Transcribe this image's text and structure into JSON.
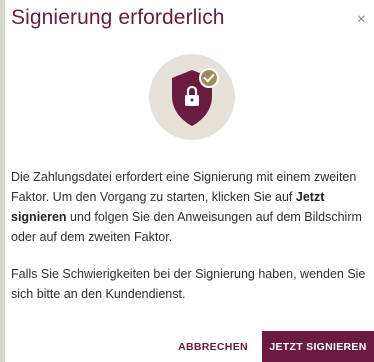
{
  "dialog": {
    "title": "Signierung erforderlich",
    "close_label": "×",
    "paragraph1": {
      "before": "Die Zahlungsdatei erfordert eine Signierung mit einem zweiten Faktor. Um den Vorgang zu starten, klicken Sie auf ",
      "bold": "Jetzt signieren",
      "after": " und folgen Sie den Anweisungen auf dem Bildschirm oder auf dem zweiten Faktor."
    },
    "paragraph2": "Falls Sie Schwierigkeiten bei der Signierung haben, wenden Sie sich bitte an den Kundendienst.",
    "cancel_label": "ABBRECHEN",
    "sign_label": "JETZT SIGNIEREN"
  },
  "icons": {
    "emblem": "shield-lock-check-icon",
    "close": "close-icon"
  },
  "colors": {
    "brand": "#6b1b40",
    "check_badge": "#a08a5c",
    "circle": "#e6e1d8",
    "backdrop": "#d6d8d0"
  }
}
